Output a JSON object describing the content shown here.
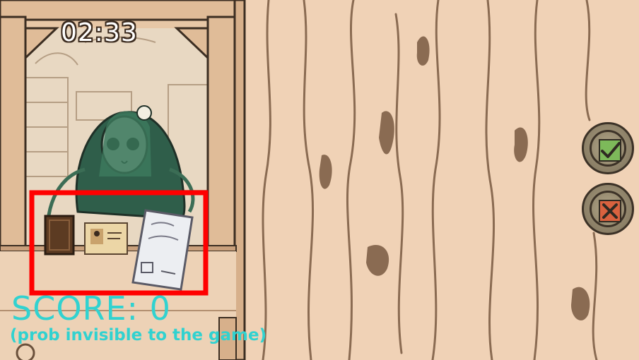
{
  "hud": {
    "timer": "02:33",
    "score_label": "SCORE: ",
    "score_value": "0",
    "note": "(prob invisible to the game)"
  },
  "actions": {
    "accept_icon": "checkmark-icon",
    "reject_icon": "cross-icon"
  },
  "scene": {
    "character": "plant-creature",
    "desk_items": [
      "passport-book-icon",
      "id-card-icon",
      "document-sheet-icon"
    ]
  },
  "colors": {
    "hud_text": "#31d2d0",
    "highlight_box": "#ff0000",
    "accept_tile": "#7db95a",
    "reject_tile": "#d9623f",
    "wood": "#f0d2b6",
    "wood_grain": "#8a6b52"
  }
}
